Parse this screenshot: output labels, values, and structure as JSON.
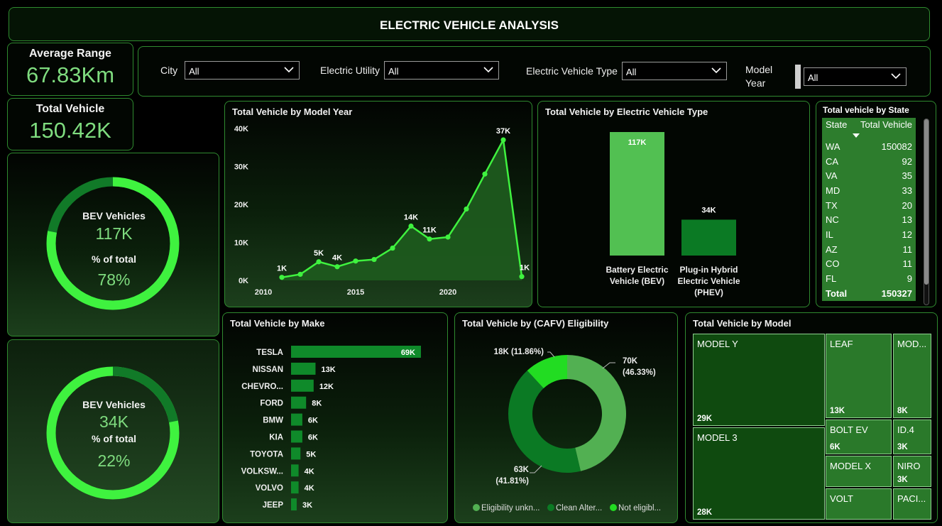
{
  "title": "ELECTRIC VEHICLE ANALYSIS",
  "kpis": {
    "avg_range_label": "Average Range",
    "avg_range_value": "67.83Km",
    "total_vehicle_label": "Total Vehicle",
    "total_vehicle_value": "150.42K"
  },
  "filters": [
    {
      "label": "City",
      "value": "All"
    },
    {
      "label": "Electric Utility",
      "value": "All"
    },
    {
      "label": "Electric Vehicle Type",
      "value": "All"
    },
    {
      "label": "Model Year",
      "value": "All"
    }
  ],
  "donut_bev": {
    "label": "BEV Vehicles",
    "value": "117K",
    "pct_label": "% of total",
    "pct": "78%",
    "fraction": 0.78
  },
  "donut_phev": {
    "label": "BEV Vehicles",
    "value": "34K",
    "pct_label": "% of total",
    "pct": "22%",
    "fraction": 0.22
  },
  "colors": {
    "accent": "#4cf04c",
    "dark_green": "#0e7a26",
    "mid_green": "#52b052",
    "border": "#2f8a2f"
  },
  "chart_data": [
    {
      "type": "area",
      "title": "Total Vehicle by Model Year",
      "x": [
        2011,
        2012,
        2013,
        2014,
        2015,
        2016,
        2017,
        2018,
        2019,
        2020,
        2021,
        2022,
        2023,
        2024
      ],
      "values": [
        800,
        1600,
        4900,
        3600,
        5100,
        5500,
        8500,
        14300,
        10900,
        11400,
        18800,
        28000,
        37000,
        1000
      ],
      "data_labels": [
        {
          "x": 2011,
          "text": "1K"
        },
        {
          "x": 2013,
          "text": "5K"
        },
        {
          "x": 2014,
          "text": "4K"
        },
        {
          "x": 2018,
          "text": "14K"
        },
        {
          "x": 2019,
          "text": "11K"
        },
        {
          "x": 2023,
          "text": "37K"
        },
        {
          "x": 2024,
          "text": "1K"
        }
      ],
      "y_ticks": [
        "0K",
        "10K",
        "20K",
        "30K",
        "40K"
      ],
      "x_ticks": [
        "2010",
        "2015",
        "2020"
      ],
      "xlim": [
        2010,
        2024
      ],
      "ylim": [
        0,
        40000
      ]
    },
    {
      "type": "bar",
      "title": "Total Vehicle by Electric Vehicle Type",
      "categories": [
        [
          "Battery Electric",
          "Vehicle (BEV)"
        ],
        [
          "Plug-in Hybrid",
          "Electric Vehicle",
          "(PHEV)"
        ]
      ],
      "values": [
        117000,
        34000
      ],
      "data_labels": [
        "117K",
        "34K"
      ],
      "ylim": [
        0,
        117000
      ]
    },
    {
      "type": "table",
      "title": "Total vehicle by State",
      "columns": [
        "State",
        "Total Vehicle"
      ],
      "rows": [
        [
          "WA",
          "150082"
        ],
        [
          "CA",
          "92"
        ],
        [
          "VA",
          "35"
        ],
        [
          "MD",
          "33"
        ],
        [
          "TX",
          "20"
        ],
        [
          "NC",
          "13"
        ],
        [
          "IL",
          "12"
        ],
        [
          "AZ",
          "11"
        ],
        [
          "CO",
          "11"
        ],
        [
          "FL",
          "9"
        ]
      ],
      "total": [
        "Total",
        "150327"
      ]
    },
    {
      "type": "bar",
      "title": "Total Vehicle by Make",
      "categories": [
        "TESLA",
        "NISSAN",
        "CHEVRO...",
        "FORD",
        "BMW",
        "KIA",
        "TOYOTA",
        "VOLKSW...",
        "VOLVO",
        "JEEP"
      ],
      "values": [
        69000,
        13000,
        12000,
        8000,
        6000,
        6000,
        5000,
        4000,
        4000,
        3000
      ],
      "data_labels": [
        "69K",
        "13K",
        "12K",
        "8K",
        "6K",
        "6K",
        "5K",
        "4K",
        "4K",
        "3K"
      ],
      "xlim": [
        0,
        69000
      ]
    },
    {
      "type": "pie",
      "title": "Total Vehicle by (CAFV) Eligibility",
      "labels": [
        "Eligibility unkn...",
        "Clean Alter...",
        "Not eligibl..."
      ],
      "values": [
        46.33,
        41.81,
        11.86
      ],
      "slice_labels": [
        [
          "70K",
          "(46.33%)"
        ],
        [
          "63K",
          "(41.81%)"
        ],
        [
          "18K (11.86%)"
        ]
      ],
      "colors": [
        "#52b052",
        "#0b7a24",
        "#22dc22"
      ]
    },
    {
      "type": "heatmap",
      "title": "Total Vehicle by Model",
      "tiles": [
        {
          "name": "MODEL Y",
          "value": "29K"
        },
        {
          "name": "MODEL 3",
          "value": "28K"
        },
        {
          "name": "LEAF",
          "value": "13K"
        },
        {
          "name": "MOD...",
          "value": "8K"
        },
        {
          "name": "BOLT EV",
          "value": "6K"
        },
        {
          "name": "ID.4",
          "value": "3K"
        },
        {
          "name": "MODEL X",
          "value": ""
        },
        {
          "name": "NIRO",
          "value": "3K"
        },
        {
          "name": "VOLT",
          "value": ""
        },
        {
          "name": "PACI...",
          "value": ""
        }
      ]
    }
  ]
}
